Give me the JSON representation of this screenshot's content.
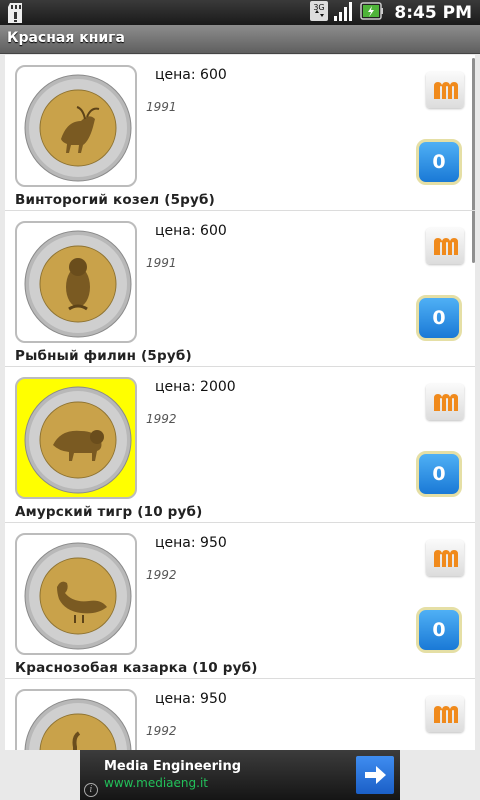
{
  "status_bar": {
    "time": "8:45 PM",
    "network": "3G"
  },
  "app": {
    "title": "Красная книга"
  },
  "items": [
    {
      "price": "цена: 600",
      "year": "1991",
      "name": "Винторогий козел (5руб)",
      "count": "0",
      "highlighted": false
    },
    {
      "price": "цена: 600",
      "year": "1991",
      "name": "Рыбный филин (5руб)",
      "count": "0",
      "highlighted": false
    },
    {
      "price": "цена: 2000",
      "year": "1992",
      "name": "Амурский тигр (10 руб)",
      "count": "0",
      "highlighted": true
    },
    {
      "price": "цена: 950",
      "year": "1992",
      "name": "Краснозобая казарка (10 руб)",
      "count": "0",
      "highlighted": false
    },
    {
      "price": "цена: 950",
      "year": "1992",
      "name": "",
      "count": "",
      "highlighted": false
    }
  ],
  "ad": {
    "title": "Media Engineering",
    "url": "www.mediaeng.it",
    "info": "i"
  },
  "colors": {
    "highlight": "#ffff00",
    "count_button": "#2a8ae6",
    "m_icon": "#f08a1c",
    "ad_url": "#22c05a"
  }
}
